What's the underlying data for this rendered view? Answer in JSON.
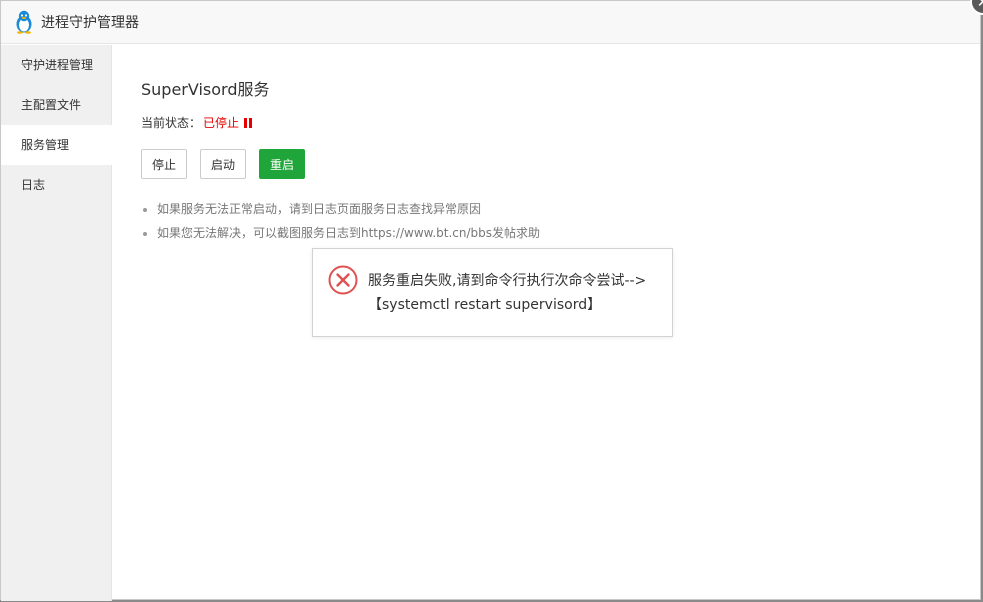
{
  "window": {
    "title": "进程守护管理器",
    "close_label": "✕"
  },
  "sidebar": {
    "items": [
      {
        "label": "守护进程管理",
        "active": false
      },
      {
        "label": "主配置文件",
        "active": false
      },
      {
        "label": "服务管理",
        "active": true
      },
      {
        "label": "日志",
        "active": false
      }
    ]
  },
  "main": {
    "title": "SuperVisord服务",
    "status_label": "当前状态：",
    "status_value": "已停止",
    "status_color": "#e60000",
    "buttons": {
      "stop": "停止",
      "start": "启动",
      "restart": "重启"
    },
    "tips": [
      "如果服务无法正常启动，请到日志页面服务日志查找异常原因",
      "如果您无法解决，可以截图服务日志到https://www.bt.cn/bbs发帖求助"
    ]
  },
  "toast": {
    "line1": "服务重启失败,请到命令行执行次命令尝试-->",
    "line2": "【systemctl restart supervisord】",
    "icon": "error-circle-x-icon"
  },
  "colors": {
    "accent_green": "#20a53a",
    "error_red": "#e60000"
  }
}
